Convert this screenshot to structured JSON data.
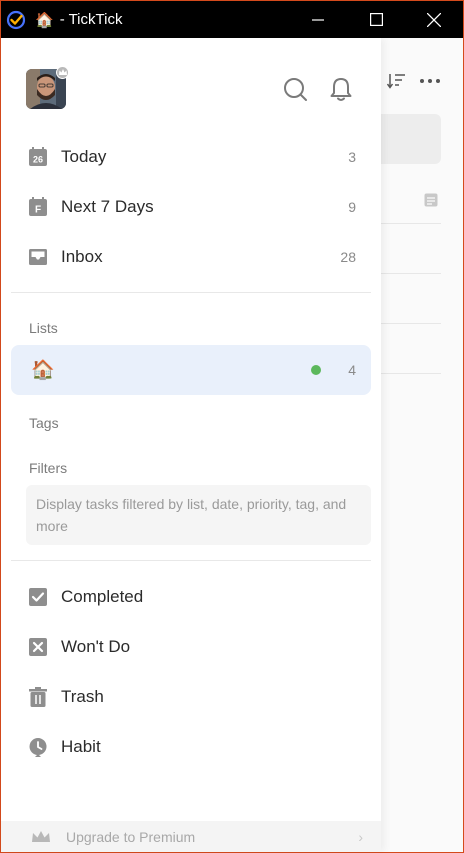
{
  "window": {
    "title": "- TickTick",
    "list_emoji": "🏠"
  },
  "colors": {
    "accent": "#4772fa",
    "active_bg": "#e9f0fb",
    "dot_green": "#5cb85c",
    "titlebar": "#000000"
  },
  "header": {
    "avatar_icon": "user-avatar",
    "search_icon": "search-icon",
    "bell_icon": "bell-icon"
  },
  "smart_lists": [
    {
      "label": "Today",
      "count": "3",
      "icon": "calendar-26-icon",
      "icon_text": "26"
    },
    {
      "label": "Next 7 Days",
      "count": "9",
      "icon": "calendar-f-icon",
      "icon_text": "F"
    },
    {
      "label": "Inbox",
      "count": "28",
      "icon": "inbox-icon"
    }
  ],
  "lists": {
    "heading": "Lists",
    "items": [
      {
        "label": "🏠",
        "count": "4",
        "active": true
      }
    ]
  },
  "tags": {
    "heading": "Tags"
  },
  "filters": {
    "heading": "Filters",
    "hint": "Display tasks filtered by list, date, priority, tag, and more"
  },
  "system_lists": [
    {
      "label": "Completed",
      "icon": "checkbox-icon"
    },
    {
      "label": "Won't Do",
      "icon": "x-box-icon"
    },
    {
      "label": "Trash",
      "icon": "trash-icon"
    },
    {
      "label": "Habit",
      "icon": "habit-icon"
    }
  ],
  "footer": {
    "upgrade_label": "Upgrade to Premium",
    "chevron": "›"
  }
}
